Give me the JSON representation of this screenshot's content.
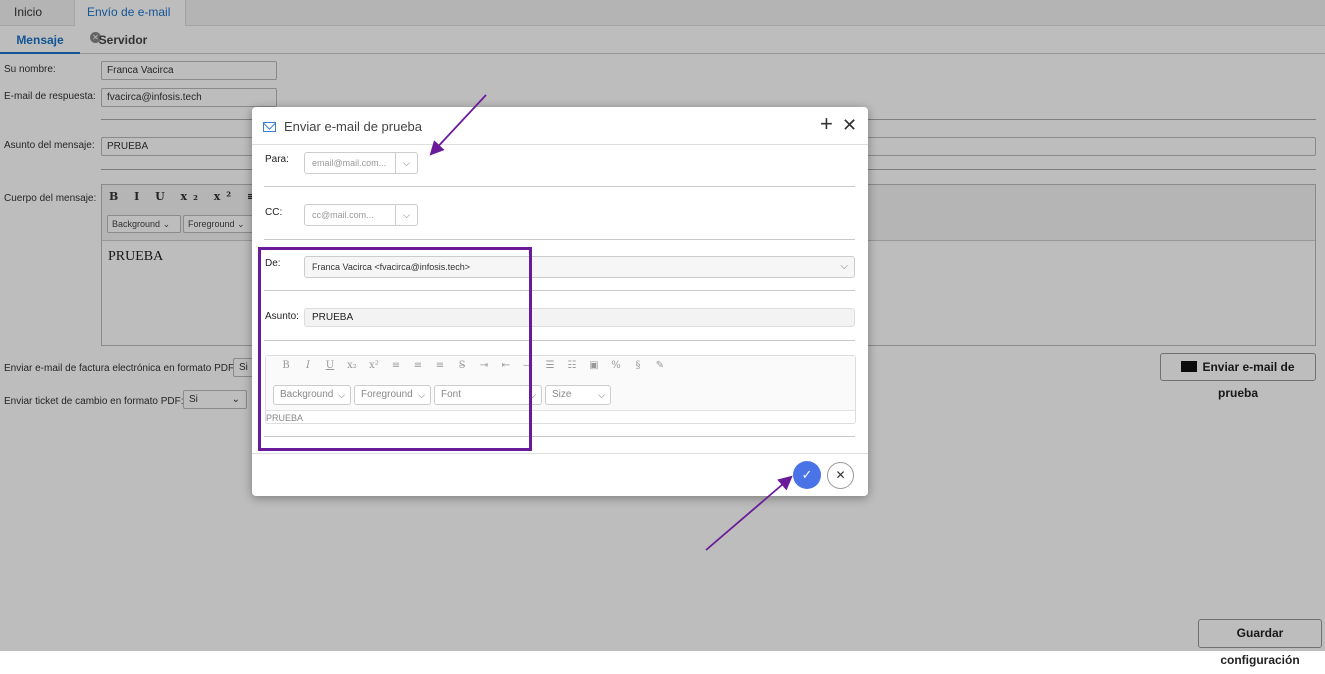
{
  "top_tabs": [
    {
      "label": "Inicio"
    },
    {
      "label": "Envío de e-mail"
    }
  ],
  "sub_tabs": [
    {
      "label": "Mensaje"
    },
    {
      "label": "Servidor"
    }
  ],
  "form": {
    "nombre_label": "Su nombre:",
    "nombre_value": "Franca Vacirca",
    "email_label": "E-mail de respuesta:",
    "email_value": "fvacirca@infosis.tech",
    "asunto_label": "Asunto del mensaje:",
    "asunto_value": "PRUEBA",
    "cuerpo_label": "Cuerpo del mensaje:",
    "editor_toolbar": "B I U x₂ x² ≡ ≡",
    "background_label": "Background",
    "foreground_label": "Foreground",
    "cuerpo_value": "PRUEBA",
    "pdf_factura_label": "Enviar e-mail de factura electrónica en formato PDF:",
    "pdf_factura_value": "Si",
    "ticket_label": "Enviar ticket de cambio en formato PDF:",
    "ticket_value": "Si"
  },
  "buttons": {
    "enviar_prueba": "Enviar e-mail de prueba",
    "guardar": "Guardar configuración"
  },
  "modal": {
    "title": "Enviar e-mail de prueba",
    "para_label": "Para:",
    "para_placeholder": "email@mail.com...",
    "cc_label": "CC:",
    "cc_placeholder": "cc@mail.com...",
    "de_label": "De:",
    "de_value": "Franca Vacirca <fvacirca@infosis.tech>",
    "asunto_label": "Asunto:",
    "asunto_value": "PRUEBA",
    "editor": {
      "background": "Background",
      "foreground": "Foreground",
      "font": "Font",
      "size": "Size",
      "body": "PRUEBA"
    }
  },
  "colors": {
    "accent": "#1a73c9",
    "confirm": "#4a73e8",
    "annotation": "#6a1b9a"
  }
}
